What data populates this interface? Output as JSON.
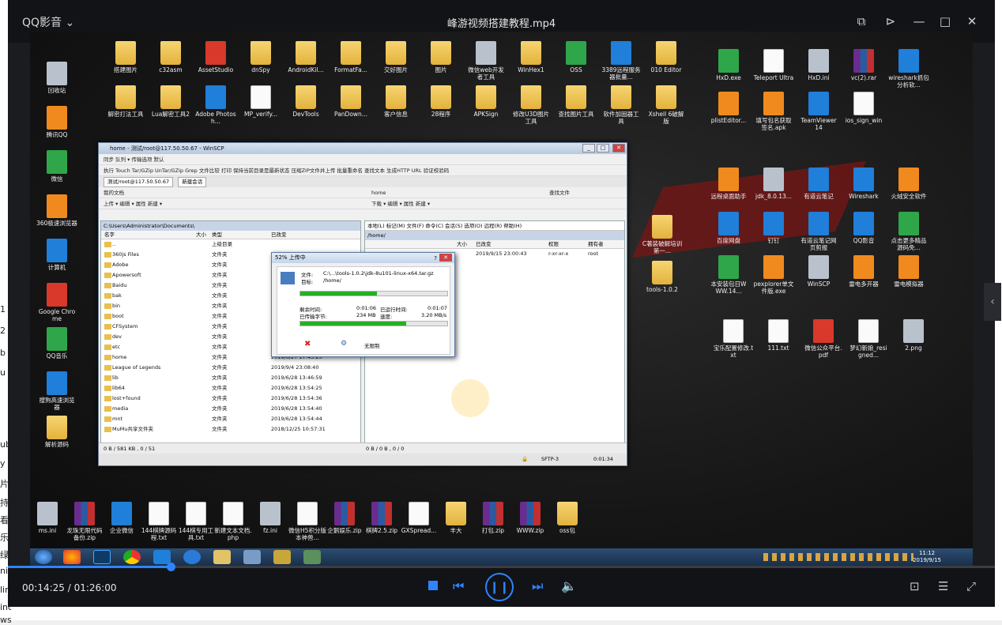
{
  "background_page_fragments": [
    "1",
    "2",
    "b",
    "u",
    "ub",
    "y",
    "片",
    "持",
    "看",
    "乐",
    "绿",
    "ni",
    "lin",
    "indows7 (64)",
    "ws7 (64)"
  ],
  "player": {
    "brand": "QQ影音",
    "title": "峰游视频搭建教程.mp4",
    "time": "00:14:25 / 01:26:00",
    "progress_fraction": 0.168
  },
  "desktop": {
    "left_icons": [
      "回收站",
      "腾讯QQ",
      "微信",
      "360极速浏览器",
      "计算机",
      "Google Chrome",
      "QQ音乐",
      "搜狗高速浏览器",
      "解析源码"
    ],
    "top_row1": [
      "搭建图片",
      "c32asm",
      "AssetStudio",
      "dnSpy",
      "AndroidKil...",
      "FormatFa...",
      "交好图片",
      "图片",
      "微信web开发者工具",
      "WinHex1",
      "OSS",
      "3389远程服务器批量...",
      "010 Editor"
    ],
    "top_row2": [
      "解密打法工具",
      "Lua解密工具2",
      "Adobe Photosh...",
      "MP_verify...",
      "DevTools",
      "PanDown...",
      "客户信息",
      "28程序",
      "APKSign",
      "修改U3D图片工具",
      "查找图片工具",
      "软件加固器工具",
      "Xshell 6破解版"
    ],
    "right_row1": [
      "HxD.exe",
      "Teleport Ultra",
      "HxD.ini",
      "vc(2).rar",
      "wireshark抓包分析软..."
    ],
    "right_row2": [
      "plistEditor...",
      "填写包名获取签名.apk",
      "TeamViewer 14",
      "ios_sign_win"
    ],
    "right_row3": [
      "远程桌面助手",
      "jdk_8.0.13...",
      "有道云笔记",
      "Wireshark",
      "火绒安全软件"
    ],
    "right_row4": [
      "百度网盘",
      "钉钉",
      "有道云笔记网页剪报",
      "QQ影音",
      "点击更多精品源码免..."
    ],
    "right_row5": [
      "本安装包日WWW.14...",
      "pexplorer单文件版.exe",
      "WinSCP",
      "雷电多开器",
      "雷电模拟器"
    ],
    "right_mid": [
      "C著装破解培训第一...",
      "tools-1.0.2"
    ],
    "right_row6": [
      "宝乐配置修改.txt",
      "111.txt",
      "微信公众平台.pdf",
      "梦幻新娘_resigned...",
      "2.png"
    ],
    "bottom_row": [
      "ms.ini",
      "龙珠无限代码备份.zip",
      "企业微信",
      "144棋牌源码程.txt",
      "144棋专用工具.txt",
      "新建文本文档.php",
      "fz.ini",
      "微信H5积分版本神兽...",
      "企鹅娱乐.zip",
      "棋牌2.5.zip",
      "GXSpread...",
      "丰大",
      "打包.zip",
      "WWW.zip",
      "oss包"
    ]
  },
  "winscp": {
    "title": "home - 测试/root@117.50.50.67 - WinSCP",
    "toolbar1": "同步  队列 ▾  传输选项 默认",
    "toolbar2": "执行  Touch  Tar/GZip  UnTar/GZip  Grep  文件比较  打印  保持当前目录是最新状态  压缩ZIP文件并上传  批量重命名  查找文本  生成HTTP URL  验证校验码",
    "session_tab": "测试/root@117.50.50.67",
    "new_session": "新建会话",
    "left_drive": "我的文档",
    "right_drive": "home",
    "left_actions": "上传 ▾  编辑 ▾  属性  新建 ▾",
    "right_actions": "下载 ▾  编辑 ▾  属性  新建 ▾",
    "right_find": "查找文件",
    "remote_menu": "本地(L)  标记(M)  文件(F)  命令(C)  会话(S)  选项(O)  远程(R)  帮助(H)",
    "left_path": "C:\\Users\\Administrator\\Documents\\",
    "right_path": "/home/",
    "left_headers": [
      "名字",
      "大小",
      "类型",
      "已改变"
    ],
    "right_headers": [
      "大小",
      "已改变",
      "权限",
      "拥有者"
    ],
    "left_rows": [
      [
        "..",
        "上级目录",
        ""
      ],
      [
        "360js Files",
        "文件夹",
        ""
      ],
      [
        "Adobe",
        "文件夹",
        ""
      ],
      [
        "Apowersoft",
        "文件夹",
        ""
      ],
      [
        "Baidu",
        "文件夹",
        ""
      ],
      [
        "bak",
        "文件夹",
        ""
      ],
      [
        "bin",
        "文件夹",
        ""
      ],
      [
        "boot",
        "文件夹",
        ""
      ],
      [
        "CFSystem",
        "文件夹",
        ""
      ],
      [
        "dev",
        "文件夹",
        ""
      ],
      [
        "etc",
        "文件夹",
        ""
      ],
      [
        "home",
        "文件夹",
        "2019/6/27  17:43:25"
      ],
      [
        "League of Legends",
        "文件夹",
        "2019/9/4  23:08:40"
      ],
      [
        "lib",
        "文件夹",
        "2019/6/28  13:46:59"
      ],
      [
        "lib64",
        "文件夹",
        "2019/6/28  13:54:25"
      ],
      [
        "lost+found",
        "文件夹",
        "2019/6/28  13:54:36"
      ],
      [
        "media",
        "文件夹",
        "2019/6/28  13:54:40"
      ],
      [
        "mnt",
        "文件夹",
        "2019/6/28  13:54:44"
      ],
      [
        "MuMu共享文件夹",
        "文件夹",
        "2018/12/25  10:57:31"
      ]
    ],
    "right_row": [
      "2019/9/15 23:00:43",
      "r-xr-xr-x",
      "root"
    ],
    "left_status": "0 B / 581 KB , 0 / 51",
    "right_status": "0 B / 0 B , 0 / 0",
    "protocol": "SFTP-3",
    "elapsed": "0:01:34"
  },
  "progress": {
    "title": "52% 上传中",
    "file_label": "文件:",
    "file_value": "C:\\...\\tools-1.0.2\\jdk-8u101-linux-x64.tar.gz",
    "target_label": "目标:",
    "target_value": "/home/",
    "time_label": "剩余时间:",
    "time_value": "0:01:06",
    "elapsed_label": "已运行时间:",
    "elapsed_value": "0:01:07",
    "bytes_label": "已传输字节:",
    "bytes_value": "234 MB",
    "speed_label": "速度:",
    "speed_value": "3.20 MB/s",
    "file_fraction": 0.52,
    "total_fraction": 0.72,
    "limit": "无限制"
  },
  "taskbar": {
    "time": "11:12",
    "date": "2019/9/15"
  }
}
